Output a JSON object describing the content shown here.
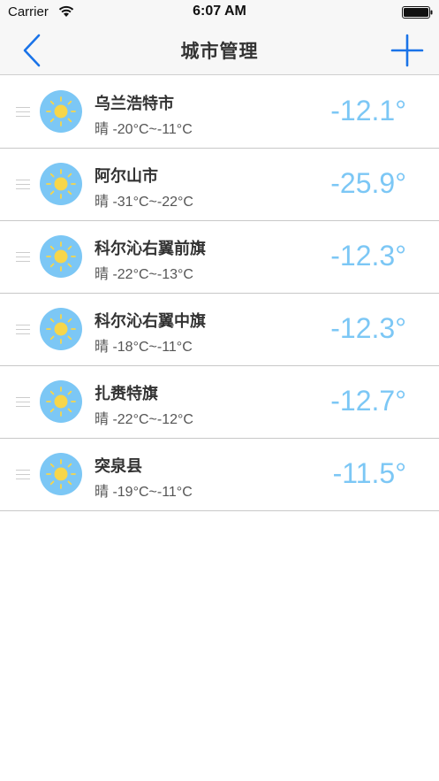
{
  "status_bar": {
    "carrier": "Carrier",
    "time": "6:07 AM"
  },
  "nav": {
    "title": "城市管理",
    "back_icon": "chevron-left-icon",
    "add_icon": "plus-icon",
    "accent_color": "#1a73e8"
  },
  "cities": [
    {
      "name": "乌兰浩特市",
      "condition": "晴 -20°C~-11°C",
      "temp": "-12.1°",
      "icon": "sun-icon"
    },
    {
      "name": "阿尔山市",
      "condition": "晴 -31°C~-22°C",
      "temp": "-25.9°",
      "icon": "sun-icon"
    },
    {
      "name": "科尔沁右翼前旗",
      "condition": "晴 -22°C~-13°C",
      "temp": "-12.3°",
      "icon": "sun-icon"
    },
    {
      "name": "科尔沁右翼中旗",
      "condition": "晴 -18°C~-11°C",
      "temp": "-12.3°",
      "icon": "sun-icon"
    },
    {
      "name": "扎赉特旗",
      "condition": "晴 -22°C~-12°C",
      "temp": "-12.7°",
      "icon": "sun-icon"
    },
    {
      "name": "突泉县",
      "condition": "晴 -19°C~-11°C",
      "temp": "-11.5°",
      "icon": "sun-icon"
    }
  ],
  "colors": {
    "temp_color": "#7cc7f5",
    "sun_color": "#f7d64a",
    "icon_bg": "#7cc7f5"
  }
}
